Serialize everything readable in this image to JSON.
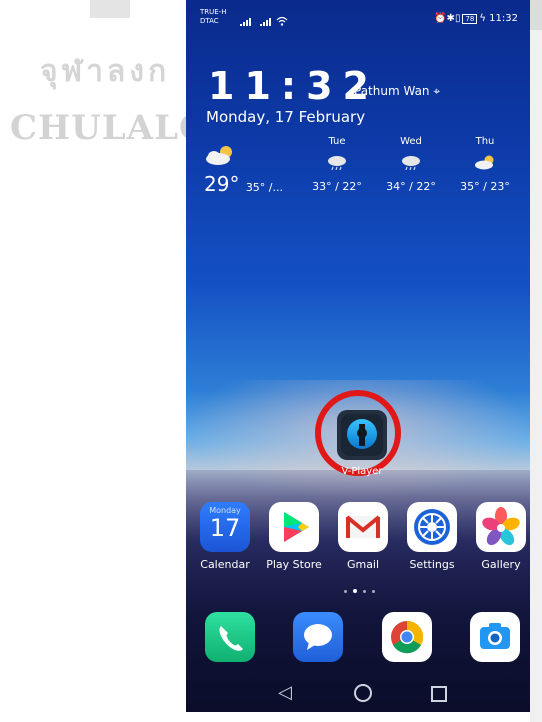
{
  "watermark": {
    "thai_text": "จุฬาลงก",
    "english_text": "CHULALON"
  },
  "status_bar": {
    "carrier_1": "TRUE-H",
    "carrier_2": "DTAC",
    "battery": "78",
    "time": "11:32",
    "icons": [
      "signal-icon",
      "signal-icon",
      "wifi-icon",
      "alarm-icon",
      "bluetooth-icon",
      "vibrate-icon",
      "battery-icon",
      "charging-icon"
    ]
  },
  "clock_widget": {
    "time": "11:32",
    "location": "Pathum Wan",
    "date": "Monday, 17 February"
  },
  "weather_widget": {
    "today": {
      "temp": "29°",
      "range": "35° /...",
      "icon": "partly-cloudy-icon"
    },
    "forecast": [
      {
        "day": "Tue",
        "range": "33° / 22°",
        "icon": "rain-cloud-icon"
      },
      {
        "day": "Wed",
        "range": "34° / 22°",
        "icon": "rain-cloud-icon"
      },
      {
        "day": "Thu",
        "range": "35° / 23°",
        "icon": "partly-cloudy-icon"
      }
    ]
  },
  "highlighted_app": {
    "label": "V-Player",
    "highlight_color": "#e01818"
  },
  "app_row": [
    {
      "label": "Calendar",
      "icon_day": "Monday",
      "icon_date": "17"
    },
    {
      "label": "Play Store"
    },
    {
      "label": "Gmail"
    },
    {
      "label": "Settings"
    },
    {
      "label": "Gallery"
    }
  ],
  "dock": [
    {
      "name": "phone",
      "icon": "phone-icon"
    },
    {
      "name": "messages",
      "icon": "message-icon"
    },
    {
      "name": "chrome",
      "icon": "chrome-icon"
    },
    {
      "name": "camera",
      "icon": "camera-icon"
    }
  ],
  "page_indicator": {
    "pages": 4,
    "current": 2
  },
  "nav_bar": {
    "buttons": [
      "back",
      "home",
      "recents"
    ]
  }
}
